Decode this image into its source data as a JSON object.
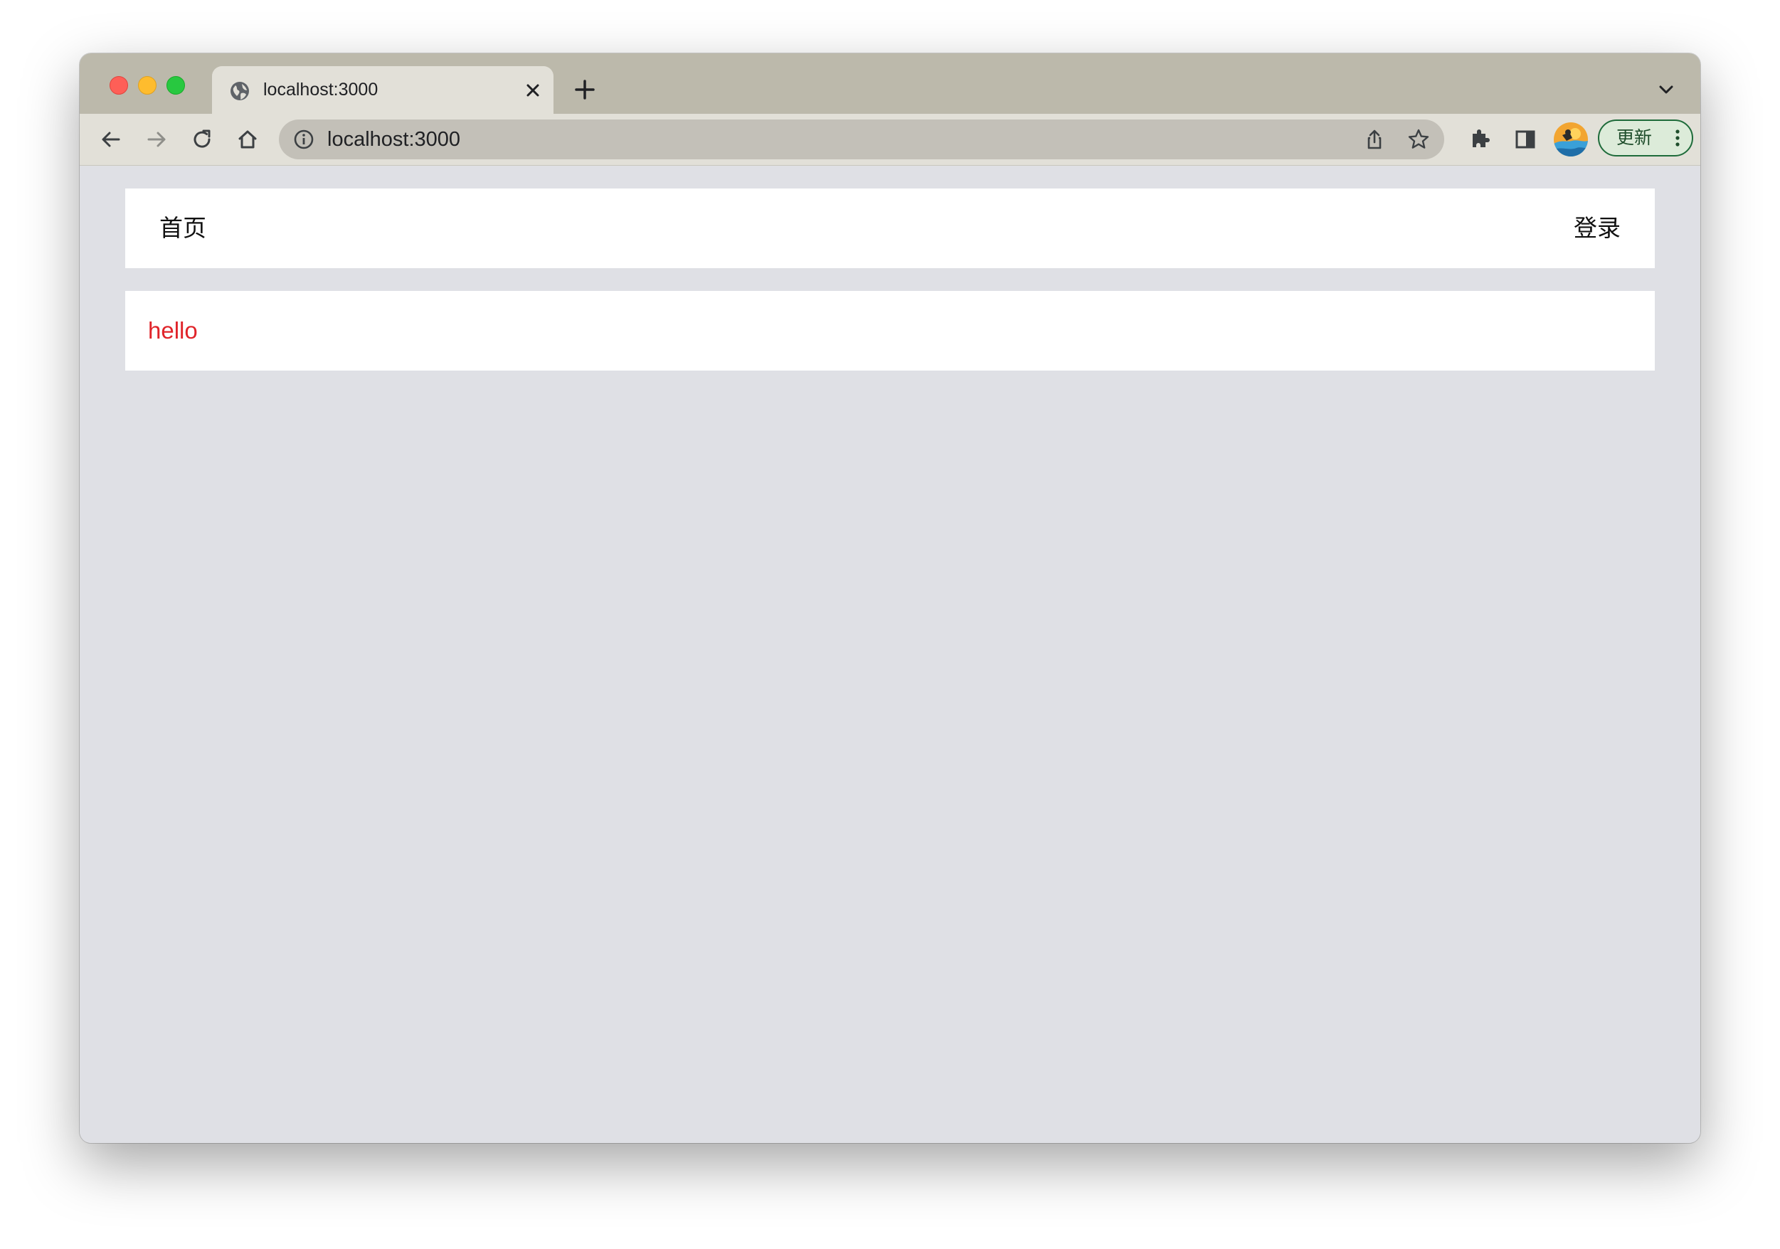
{
  "browser": {
    "tab": {
      "title": "localhost:3000",
      "favicon": "globe-icon"
    },
    "omnibox": {
      "url": "localhost:3000",
      "info_icon": "info-icon"
    },
    "update_button": {
      "label": "更新"
    },
    "accent_color": "#1e6b3a"
  },
  "page": {
    "nav": {
      "home": "首页",
      "login": "登录"
    },
    "content": {
      "text": "hello",
      "text_color": "#e0242a"
    },
    "background_color": "#dfe0e5"
  }
}
